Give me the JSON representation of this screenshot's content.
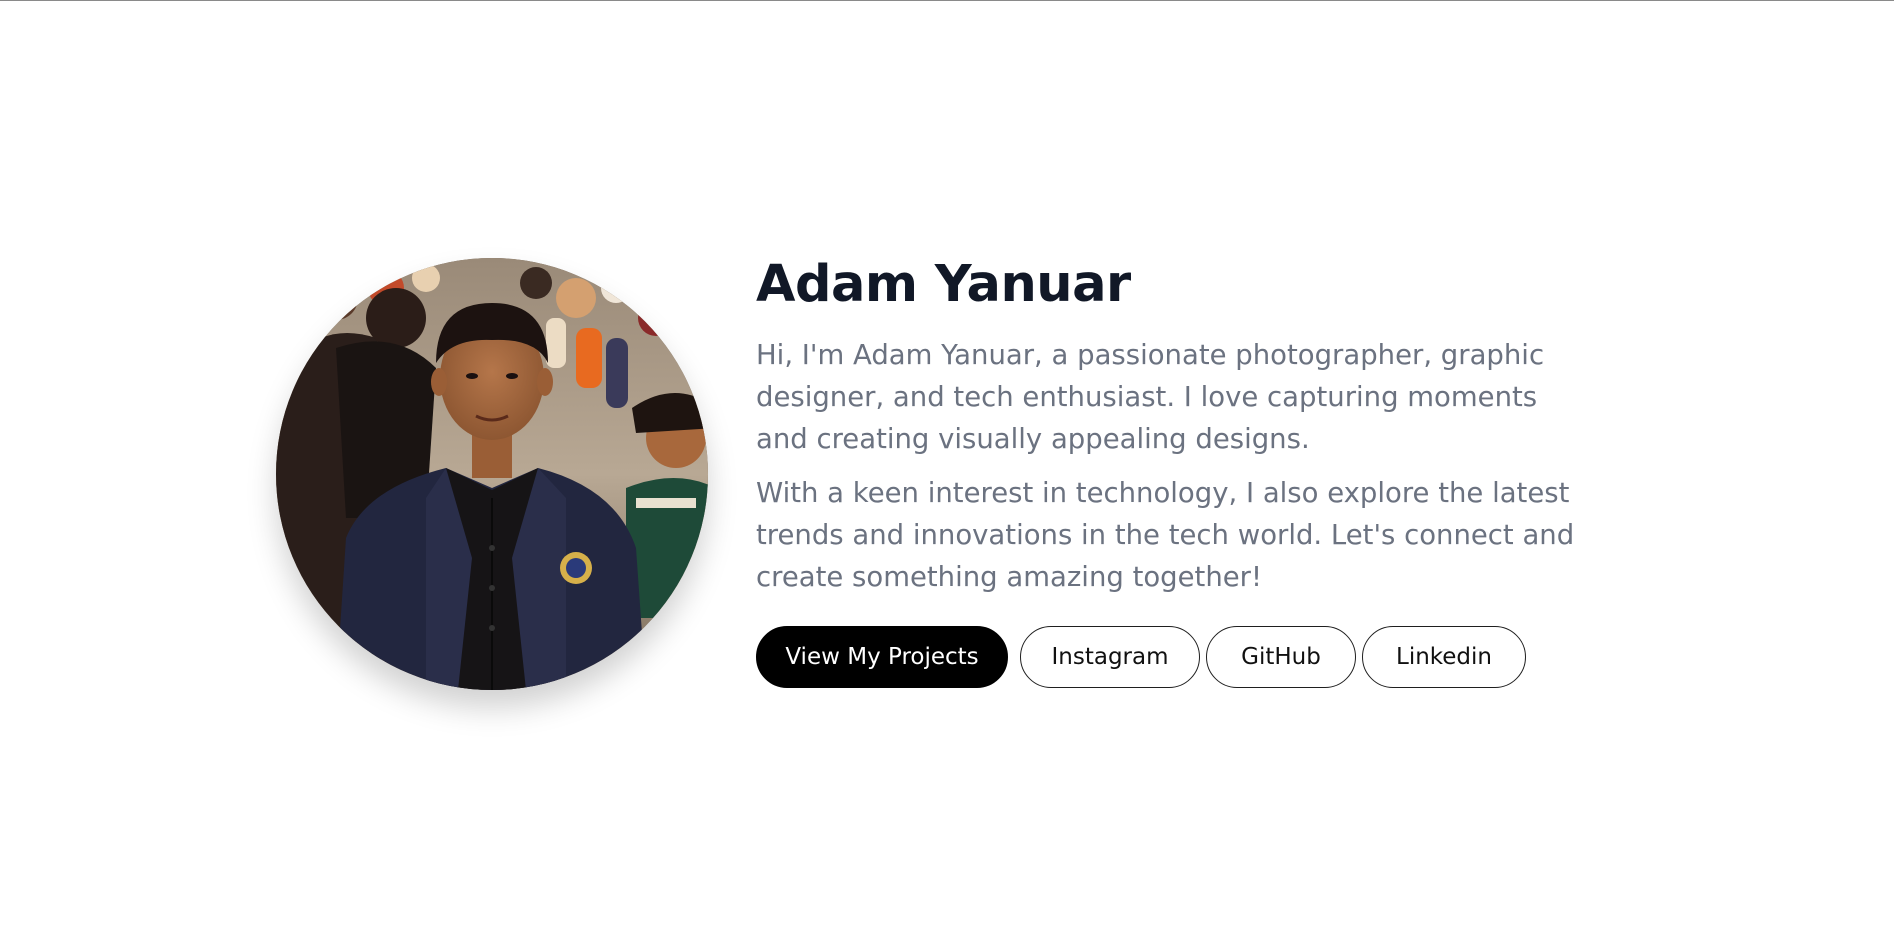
{
  "profile": {
    "name": "Adam Yanuar",
    "intro": "Hi, I'm Adam Yanuar, a passionate photographer, graphic designer, and tech enthusiast. I love capturing moments and creating visually appealing designs.",
    "interest": "With a keen interest in technology, I also explore the latest trends and innovations in the tech world. Let's connect and create something amazing together!",
    "photo_icon": "profile-photo"
  },
  "actions": {
    "primary_label": "View My Projects",
    "instagram_label": "Instagram",
    "github_label": "GitHub",
    "linkedin_label": "Linkedin"
  },
  "colors": {
    "heading": "#111827",
    "body_text": "#6b7280",
    "primary_button_bg": "#000000",
    "primary_button_text": "#ffffff",
    "outline_border": "#1f1f1f"
  }
}
